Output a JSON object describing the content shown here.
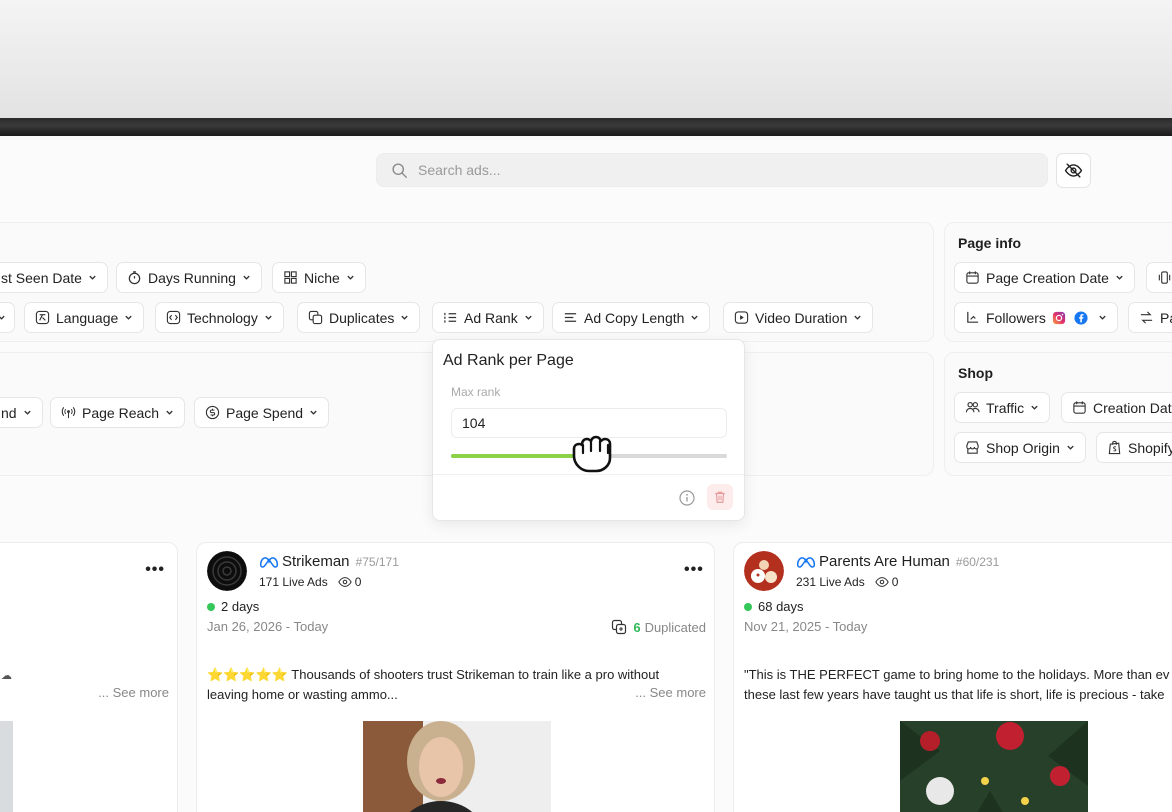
{
  "search": {
    "placeholder": "Search ads..."
  },
  "filters_panel": {
    "row1": [
      {
        "label": "st Seen Date",
        "icon": "calendar-icon"
      },
      {
        "label": "Days Running",
        "icon": "timer-icon"
      },
      {
        "label": "Niche",
        "icon": "grid-icon"
      }
    ],
    "row2": [
      {
        "label": "Language",
        "icon": "language-icon"
      },
      {
        "label": "Technology",
        "icon": "code-icon"
      },
      {
        "label": "Duplicates",
        "icon": "duplicate-icon"
      },
      {
        "label": "Ad Rank",
        "icon": "list-ordered-icon"
      },
      {
        "label": "Ad Copy Length",
        "icon": "text-lines-icon"
      },
      {
        "label": "Video Duration",
        "icon": "video-icon"
      }
    ],
    "row3": [
      {
        "label": "nd",
        "icon": ""
      },
      {
        "label": "Page Reach",
        "icon": "broadcast-icon"
      },
      {
        "label": "Page Spend",
        "icon": "dollar-circle-icon"
      }
    ]
  },
  "page_info": {
    "title": "Page info",
    "chips": [
      {
        "label": "Page Creation Date",
        "icon": "calendar-icon"
      },
      {
        "label": "Followers",
        "icon": "followers-chart-icon"
      },
      {
        "label": "Pa",
        "icon": "swap-icon"
      }
    ]
  },
  "shop": {
    "title": "Shop",
    "chips": [
      {
        "label": "Traffic",
        "icon": "users-icon"
      },
      {
        "label": "Creation Dat",
        "icon": "calendar-icon"
      },
      {
        "label": "Shop Origin",
        "icon": "store-icon"
      },
      {
        "label": "Shopify",
        "icon": "shopify-icon"
      }
    ]
  },
  "ad_rank_popover": {
    "title": "Ad Rank per Page",
    "label": "Max rank",
    "value": "104",
    "slider_fraction": 0.52
  },
  "cards": [
    {
      "see_more": "... See more"
    },
    {
      "name": "Strikeman",
      "rank": "#75/171",
      "live_ads": "171 Live Ads",
      "views": "0",
      "days": "2 days",
      "date_range": "Jan 26, 2026 - Today",
      "duplicated_count": "6",
      "duplicated_label": "Duplicated",
      "text_line1": "⭐⭐⭐⭐⭐ Thousands of shooters trust Strikeman to train like a pro without",
      "text_line2": "leaving home or wasting ammo...",
      "see_more": "... See more"
    },
    {
      "name": "Parents Are Human",
      "rank": "#60/231",
      "live_ads": "231 Live Ads",
      "views": "0",
      "days": "68 days",
      "date_range": "Nov 21, 2025 - Today",
      "text_line1": "\"This is THE PERFECT game to bring home to the holidays. More than ev",
      "text_line2": "these last few years have taught us that life is short, life is precious - take"
    }
  ],
  "colors": {
    "accent_green": "#8bd24a",
    "live_dot": "#34c759",
    "dup_count": "#2fb85a",
    "trash_bg": "#fdecec"
  }
}
